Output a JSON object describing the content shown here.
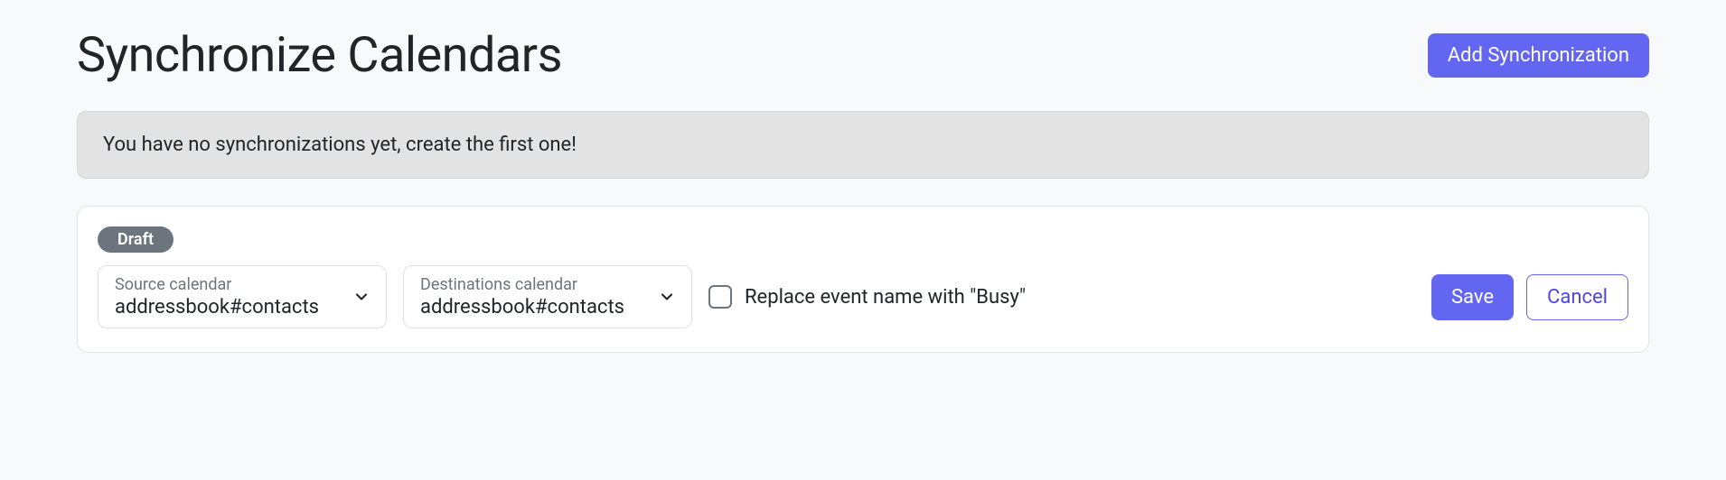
{
  "header": {
    "title": "Synchronize Calendars",
    "add_button": "Add Synchronization"
  },
  "alert": {
    "message": "You have no synchronizations yet, create the first one!"
  },
  "draft_card": {
    "badge": "Draft",
    "source": {
      "label": "Source calendar",
      "value": "addressbook#contacts"
    },
    "destination": {
      "label": "Destinations calendar",
      "value": "addressbook#contacts"
    },
    "replace_checkbox": {
      "label": "Replace event name with \"Busy\"",
      "checked": false
    },
    "save_button": "Save",
    "cancel_button": "Cancel"
  }
}
